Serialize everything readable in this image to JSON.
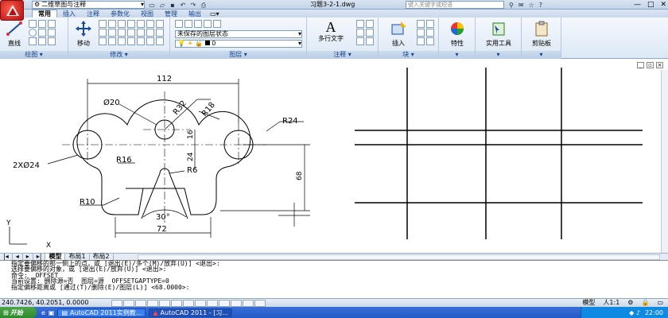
{
  "title_bar": {
    "workspace": "二维草图与注释",
    "document_title": "习题3-2-1.dwg",
    "search_placeholder": "键入关键字或短语",
    "window_controls": [
      "—",
      "□",
      "✕"
    ]
  },
  "ribbon_tabs": [
    "常用",
    "插入",
    "注释",
    "参数化",
    "视图",
    "管理",
    "输出"
  ],
  "active_tab": "常用",
  "ribbon": {
    "draw": {
      "label": "绘图",
      "line_button": "直线"
    },
    "modify": {
      "label": "修改",
      "move_button": "移动"
    },
    "layers": {
      "label": "图层",
      "layer_state": "未保存的图层状态",
      "current_layer": "0"
    },
    "annotation": {
      "label": "注释",
      "multiline_text": "多行文字"
    },
    "block": {
      "label": "块",
      "insert_button": "插入"
    },
    "properties_button": "特性",
    "utilities_button": "实用工具",
    "clipboard_button": "剪贴板"
  },
  "drawing": {
    "dims": {
      "d112": "112",
      "d20": "Ø20",
      "d32": "R32",
      "d18": "R18",
      "d24r": "R24",
      "d2x24": "2XØ24",
      "d16r": "R16",
      "d6r": "R6",
      "d10r": "R10",
      "d30": "30°",
      "d72": "72",
      "d16": "16",
      "d24": "24",
      "d68": "68"
    },
    "ucs_x": "X",
    "ucs_y": "Y"
  },
  "layout_tabs": [
    "模型",
    "布局1",
    "布局2"
  ],
  "command_history": [
    "指定要偏移的那一侧上的点，或 [退出(E)/多个(M)/放弃(U)] <退出>:",
    "选择要偏移的对象，或 [退出(E)/放弃(U)] <退出>:",
    "命令:  OFFSET",
    "当前设置: 删除源=否  图层=源  OFFSETGAPTYPE=0",
    "指定偏移距离或 [通过(T)/删除(E)/图层(L)] <68.0000>:"
  ],
  "status_bar": {
    "coords": "240.7426, 40.2051, 0.0000",
    "model": "模型",
    "scale": "人1:1"
  },
  "taskbar": {
    "start": "开始",
    "tasks": [
      "AutoCAD 2011实例教...",
      "AutoCAD 2011 - [习..."
    ],
    "clock": "22:00"
  }
}
